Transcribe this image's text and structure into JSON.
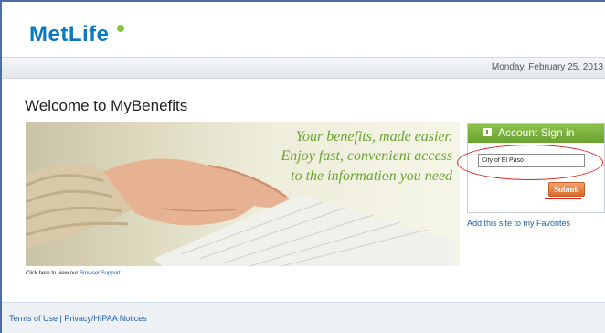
{
  "header": {
    "logo_text": "MetLife"
  },
  "datebar": {
    "date": "Monday, February 25, 2013"
  },
  "page": {
    "title": "Welcome to MyBenefits"
  },
  "hero": {
    "tagline_1": "Your benefits, made easier.",
    "tagline_2": "Enjoy fast, convenient access",
    "tagline_3": "to the information you need"
  },
  "support": {
    "prefix": "Click here to view our ",
    "link": "Browser Support"
  },
  "signin": {
    "header": "Account Sign in",
    "input_value": "City of El Paso",
    "submit_label": "Submit"
  },
  "favorites_link": "Add this site to my Favorites",
  "footer": {
    "terms": "Terms of Use",
    "separator": "|",
    "privacy": "Privacy/HIPAA Notices"
  },
  "colors": {
    "brand_blue": "#0a79bf",
    "accent_green": "#6aa230",
    "submit_orange": "#d8682d",
    "annotation_red": "#e02020"
  }
}
